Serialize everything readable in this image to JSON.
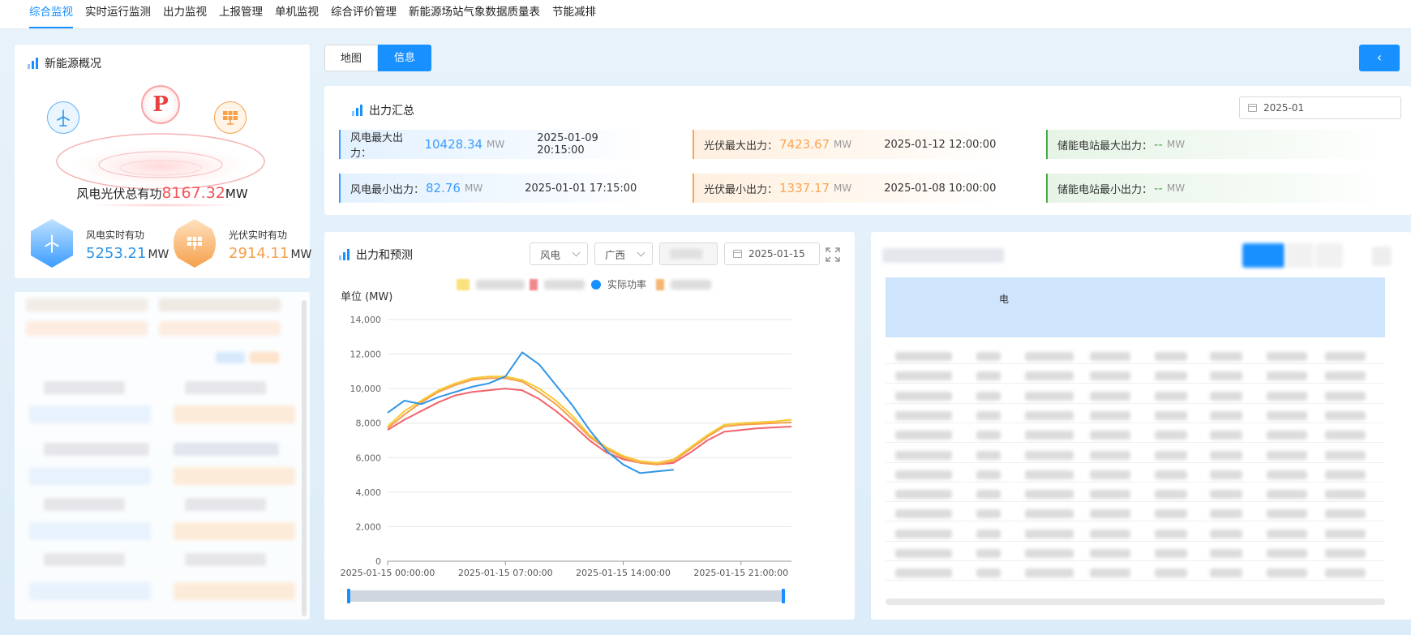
{
  "nav": {
    "tabs": [
      "综合监视",
      "实时运行监测",
      "出力监视",
      "上报管理",
      "单机监视",
      "综合评价管理",
      "新能源场站气象数据质量表",
      "节能减排"
    ],
    "active": 0
  },
  "overview": {
    "title": "新能源概况",
    "total_label": "风电光伏总有功",
    "total_value": "8167.32",
    "total_unit": "MW",
    "wind_label": "风电实时有功",
    "wind_value": "5253.21",
    "wind_unit": "MW",
    "solar_label": "光伏实时有功",
    "solar_value": "2914.11",
    "solar_unit": "MW",
    "logo_letter": "P"
  },
  "view_toggle": {
    "map": "地图",
    "info": "信息"
  },
  "back_button": "‹",
  "summary": {
    "title": "出力汇总",
    "month": "2025-01",
    "wind_max": {
      "label": "风电最大出力：",
      "value": "10428.34",
      "unit": "MW",
      "time": "2025-01-09 20:15:00"
    },
    "solar_max": {
      "label": "光伏最大出力：",
      "value": "7423.67",
      "unit": "MW",
      "time": "2025-01-12 12:00:00"
    },
    "storage_max": {
      "label": "储能电站最大出力：",
      "value": "--",
      "unit": "MW"
    },
    "wind_min": {
      "label": "风电最小出力：",
      "value": "82.76",
      "unit": "MW",
      "time": "2025-01-01 17:15:00"
    },
    "solar_min": {
      "label": "光伏最小出力：",
      "value": "1337.17",
      "unit": "MW",
      "time": "2025-01-08 10:00:00"
    },
    "storage_min": {
      "label": "储能电站最小出力：",
      "value": "--",
      "unit": "MW"
    }
  },
  "forecast": {
    "title": "出力和预测",
    "type_select": "风电",
    "region_select": "广西",
    "date": "2025-01-15",
    "legend_actual": "实际功率",
    "colors": {
      "actual": "#2f95e6",
      "yellow": "#f7c934",
      "red": "#f2636b",
      "orange": "#f5a04b"
    }
  },
  "chart_data": {
    "type": "line",
    "ylabel": "单位 (MW)",
    "ylim": [
      0,
      14000
    ],
    "yticks": [
      "14,000",
      "12,000",
      "10,000",
      "8,000",
      "6,000",
      "4,000",
      "2,000",
      "0"
    ],
    "xticks": [
      "2025-01-15 00:00:00",
      "2025-01-15 07:00:00",
      "2025-01-15 14:00:00",
      "2025-01-15 21:00:00"
    ],
    "x_hours": [
      0,
      1,
      2,
      3,
      4,
      5,
      6,
      7,
      8,
      9,
      10,
      11,
      12,
      13,
      14,
      15,
      16,
      17,
      18,
      19,
      20,
      21,
      22,
      23,
      24
    ],
    "series": [
      {
        "name": "实际功率",
        "color": "#2f95e6",
        "values": [
          8600,
          9300,
          9100,
          9500,
          9800,
          10100,
          10300,
          10700,
          12100,
          11400,
          10200,
          9000,
          7600,
          6400,
          5600,
          5100,
          5200,
          5300,
          null,
          null,
          null,
          null,
          null,
          null,
          null
        ]
      },
      {
        "color": "#f7c934",
        "values": [
          7800,
          8700,
          9300,
          9900,
          10300,
          10600,
          10700,
          10700,
          10500,
          10000,
          9300,
          8400,
          7300,
          6600,
          6100,
          5800,
          5700,
          5900,
          6600,
          7300,
          7900,
          8000,
          8050,
          8100,
          8200
        ]
      },
      {
        "color": "#f5a04b",
        "values": [
          7700,
          8500,
          9200,
          9800,
          10200,
          10500,
          10600,
          10600,
          10400,
          9800,
          9100,
          8200,
          7200,
          6500,
          6000,
          5700,
          5600,
          5800,
          6500,
          7200,
          7800,
          7900,
          7950,
          8000,
          8050
        ]
      },
      {
        "color": "#f2636b",
        "values": [
          7600,
          8200,
          8700,
          9200,
          9600,
          9800,
          9900,
          10000,
          9900,
          9400,
          8700,
          7900,
          7000,
          6300,
          5900,
          5700,
          5600,
          5700,
          6300,
          7000,
          7500,
          7600,
          7700,
          7750,
          7800
        ]
      }
    ]
  },
  "table_panel": {
    "visible_header_fragment": "电"
  }
}
